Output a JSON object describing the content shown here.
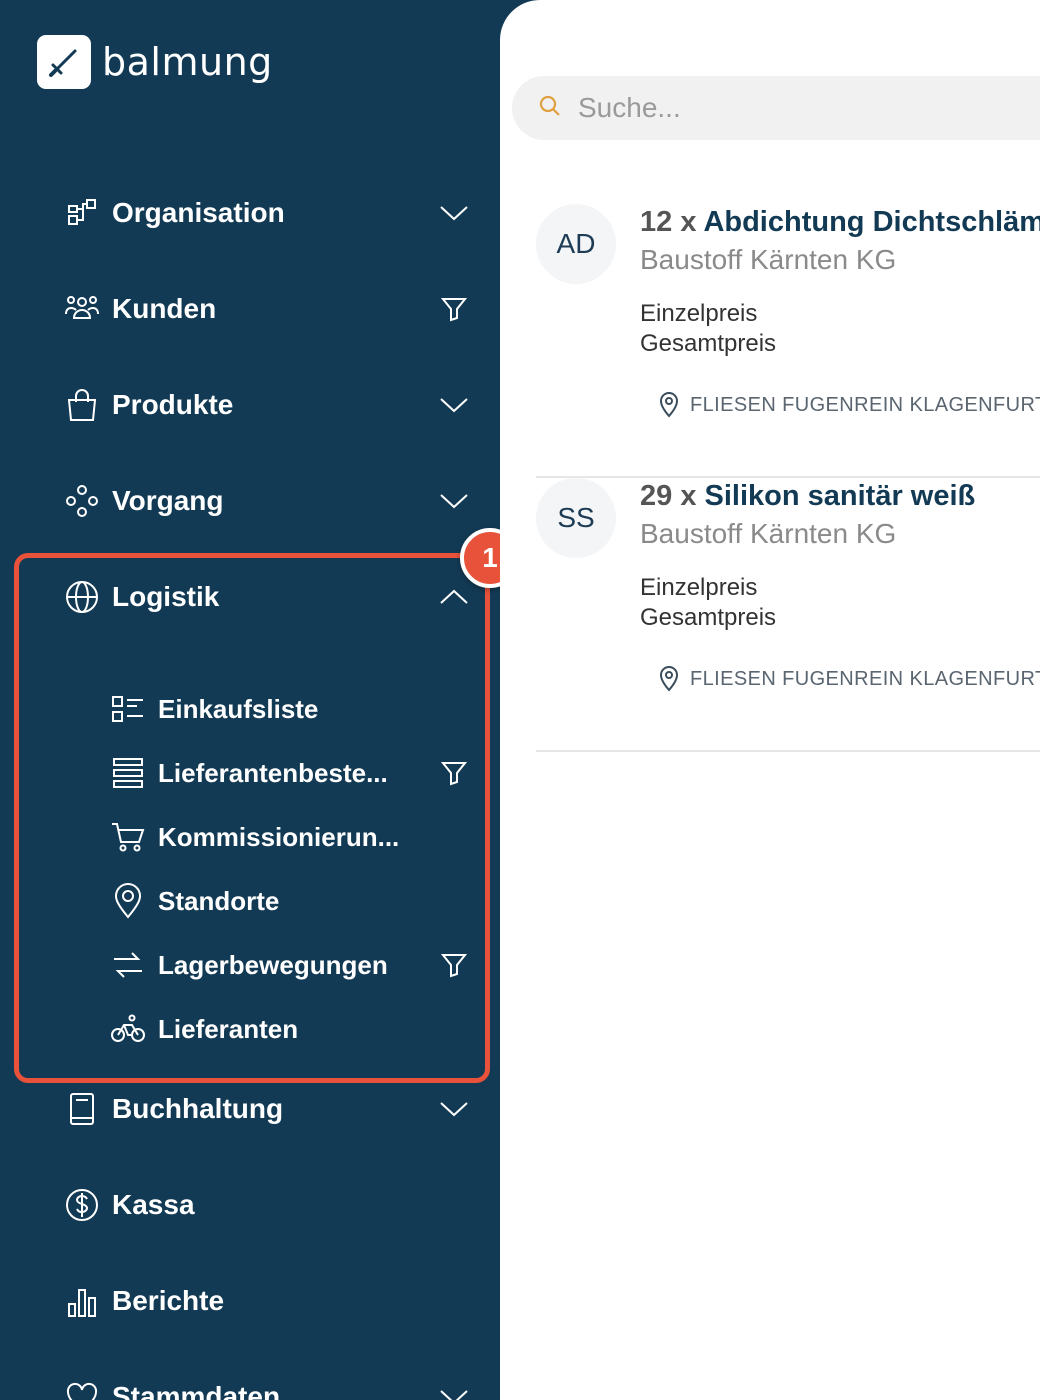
{
  "app": {
    "name": "balmung"
  },
  "colors": {
    "sidebar_bg": "#133a54",
    "accent": "#e8523a",
    "search_icon": "#e0a040"
  },
  "sidebar": {
    "items": [
      {
        "label": "Organisation",
        "icon": "org-chart-icon",
        "trail": "chevron-down-icon"
      },
      {
        "label": "Kunden",
        "icon": "users-icon",
        "trail": "filter-icon"
      },
      {
        "label": "Produkte",
        "icon": "shopping-bag-icon",
        "trail": "chevron-down-icon"
      },
      {
        "label": "Vorgang",
        "icon": "workflow-icon",
        "trail": "chevron-down-icon"
      },
      {
        "label": "Logistik",
        "icon": "globe-icon",
        "trail": "chevron-up-icon",
        "expanded": true
      },
      {
        "label": "Buchhaltung",
        "icon": "book-icon",
        "trail": "chevron-down-icon"
      },
      {
        "label": "Kassa",
        "icon": "dollar-circle-icon",
        "trail": ""
      },
      {
        "label": "Berichte",
        "icon": "bar-chart-icon",
        "trail": ""
      },
      {
        "label": "Stammdaten",
        "icon": "heart-icon",
        "trail": "chevron-down-icon"
      }
    ],
    "logistik_sub": [
      {
        "label": "Einkaufsliste",
        "icon": "list-icon",
        "trail": ""
      },
      {
        "label": "Lieferantenbeste...",
        "icon": "rows-icon",
        "trail": "filter-icon"
      },
      {
        "label": "Kommissionierun...",
        "icon": "cart-icon",
        "trail": ""
      },
      {
        "label": "Standorte",
        "icon": "location-pin-icon",
        "trail": ""
      },
      {
        "label": "Lagerbewegungen",
        "icon": "transfer-arrows-icon",
        "trail": "filter-icon"
      },
      {
        "label": "Lieferanten",
        "icon": "bicycle-icon",
        "trail": ""
      }
    ],
    "highlight_badge": "1"
  },
  "search": {
    "placeholder": "Suche..."
  },
  "orders": [
    {
      "initials": "AD",
      "qty": "12 x",
      "product": "Abdichtung Dichtschlämm",
      "supplier": "Baustoff Kärnten KG",
      "line1": "Einzelpreis",
      "line2": "Gesamtpreis",
      "location": "FLIESEN FUGENREIN KLAGENFURT G"
    },
    {
      "initials": "SS",
      "qty": "29 x",
      "product": "Silikon sanitär weiß",
      "supplier": "Baustoff Kärnten KG",
      "line1": "Einzelpreis",
      "line2": "Gesamtpreis",
      "location": "FLIESEN FUGENREIN KLAGENFURT G"
    }
  ]
}
